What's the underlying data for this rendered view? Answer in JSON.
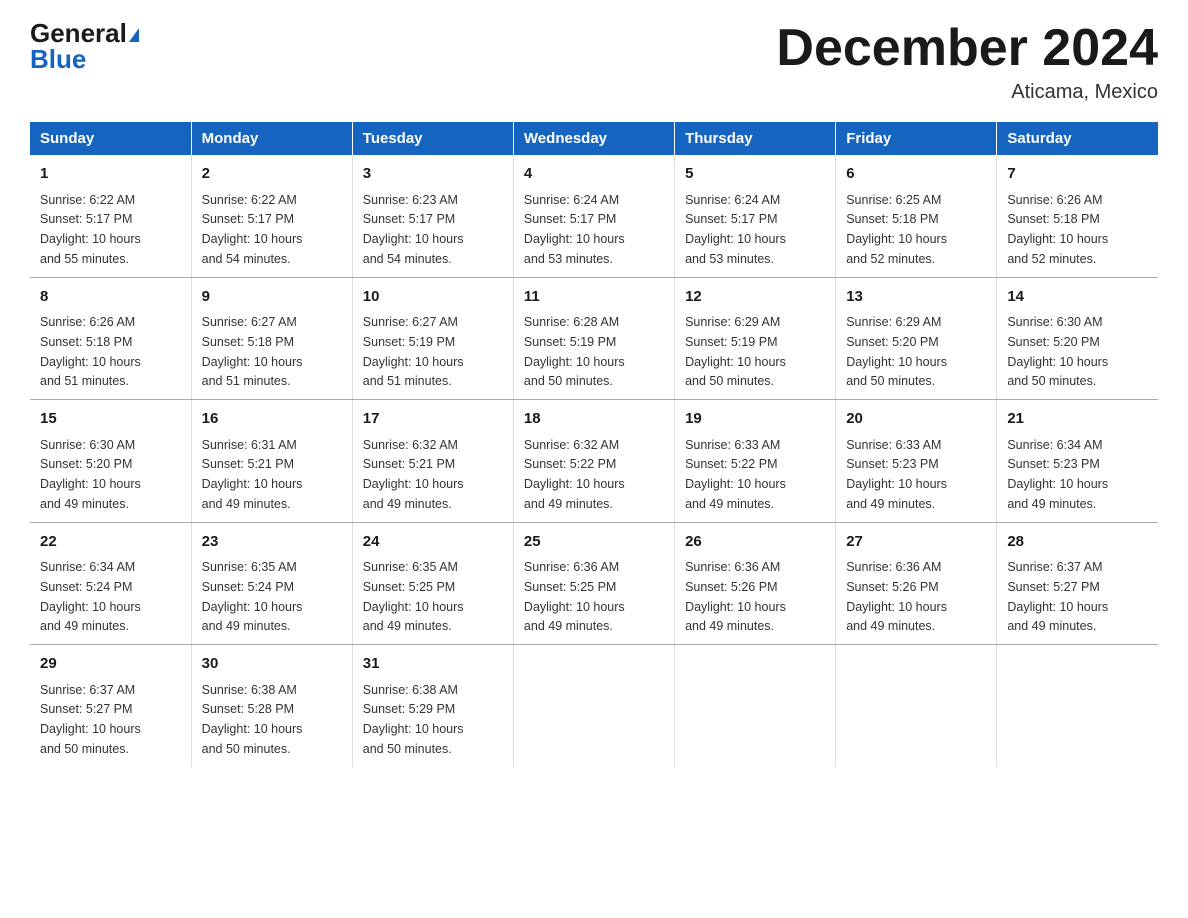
{
  "header": {
    "logo_general": "General",
    "logo_blue": "Blue",
    "month_title": "December 2024",
    "location": "Aticama, Mexico"
  },
  "days_of_week": [
    "Sunday",
    "Monday",
    "Tuesday",
    "Wednesday",
    "Thursday",
    "Friday",
    "Saturday"
  ],
  "weeks": [
    [
      {
        "day": "1",
        "sunrise": "6:22 AM",
        "sunset": "5:17 PM",
        "daylight": "10 hours and 55 minutes."
      },
      {
        "day": "2",
        "sunrise": "6:22 AM",
        "sunset": "5:17 PM",
        "daylight": "10 hours and 54 minutes."
      },
      {
        "day": "3",
        "sunrise": "6:23 AM",
        "sunset": "5:17 PM",
        "daylight": "10 hours and 54 minutes."
      },
      {
        "day": "4",
        "sunrise": "6:24 AM",
        "sunset": "5:17 PM",
        "daylight": "10 hours and 53 minutes."
      },
      {
        "day": "5",
        "sunrise": "6:24 AM",
        "sunset": "5:17 PM",
        "daylight": "10 hours and 53 minutes."
      },
      {
        "day": "6",
        "sunrise": "6:25 AM",
        "sunset": "5:18 PM",
        "daylight": "10 hours and 52 minutes."
      },
      {
        "day": "7",
        "sunrise": "6:26 AM",
        "sunset": "5:18 PM",
        "daylight": "10 hours and 52 minutes."
      }
    ],
    [
      {
        "day": "8",
        "sunrise": "6:26 AM",
        "sunset": "5:18 PM",
        "daylight": "10 hours and 51 minutes."
      },
      {
        "day": "9",
        "sunrise": "6:27 AM",
        "sunset": "5:18 PM",
        "daylight": "10 hours and 51 minutes."
      },
      {
        "day": "10",
        "sunrise": "6:27 AM",
        "sunset": "5:19 PM",
        "daylight": "10 hours and 51 minutes."
      },
      {
        "day": "11",
        "sunrise": "6:28 AM",
        "sunset": "5:19 PM",
        "daylight": "10 hours and 50 minutes."
      },
      {
        "day": "12",
        "sunrise": "6:29 AM",
        "sunset": "5:19 PM",
        "daylight": "10 hours and 50 minutes."
      },
      {
        "day": "13",
        "sunrise": "6:29 AM",
        "sunset": "5:20 PM",
        "daylight": "10 hours and 50 minutes."
      },
      {
        "day": "14",
        "sunrise": "6:30 AM",
        "sunset": "5:20 PM",
        "daylight": "10 hours and 50 minutes."
      }
    ],
    [
      {
        "day": "15",
        "sunrise": "6:30 AM",
        "sunset": "5:20 PM",
        "daylight": "10 hours and 49 minutes."
      },
      {
        "day": "16",
        "sunrise": "6:31 AM",
        "sunset": "5:21 PM",
        "daylight": "10 hours and 49 minutes."
      },
      {
        "day": "17",
        "sunrise": "6:32 AM",
        "sunset": "5:21 PM",
        "daylight": "10 hours and 49 minutes."
      },
      {
        "day": "18",
        "sunrise": "6:32 AM",
        "sunset": "5:22 PM",
        "daylight": "10 hours and 49 minutes."
      },
      {
        "day": "19",
        "sunrise": "6:33 AM",
        "sunset": "5:22 PM",
        "daylight": "10 hours and 49 minutes."
      },
      {
        "day": "20",
        "sunrise": "6:33 AM",
        "sunset": "5:23 PM",
        "daylight": "10 hours and 49 minutes."
      },
      {
        "day": "21",
        "sunrise": "6:34 AM",
        "sunset": "5:23 PM",
        "daylight": "10 hours and 49 minutes."
      }
    ],
    [
      {
        "day": "22",
        "sunrise": "6:34 AM",
        "sunset": "5:24 PM",
        "daylight": "10 hours and 49 minutes."
      },
      {
        "day": "23",
        "sunrise": "6:35 AM",
        "sunset": "5:24 PM",
        "daylight": "10 hours and 49 minutes."
      },
      {
        "day": "24",
        "sunrise": "6:35 AM",
        "sunset": "5:25 PM",
        "daylight": "10 hours and 49 minutes."
      },
      {
        "day": "25",
        "sunrise": "6:36 AM",
        "sunset": "5:25 PM",
        "daylight": "10 hours and 49 minutes."
      },
      {
        "day": "26",
        "sunrise": "6:36 AM",
        "sunset": "5:26 PM",
        "daylight": "10 hours and 49 minutes."
      },
      {
        "day": "27",
        "sunrise": "6:36 AM",
        "sunset": "5:26 PM",
        "daylight": "10 hours and 49 minutes."
      },
      {
        "day": "28",
        "sunrise": "6:37 AM",
        "sunset": "5:27 PM",
        "daylight": "10 hours and 49 minutes."
      }
    ],
    [
      {
        "day": "29",
        "sunrise": "6:37 AM",
        "sunset": "5:27 PM",
        "daylight": "10 hours and 50 minutes."
      },
      {
        "day": "30",
        "sunrise": "6:38 AM",
        "sunset": "5:28 PM",
        "daylight": "10 hours and 50 minutes."
      },
      {
        "day": "31",
        "sunrise": "6:38 AM",
        "sunset": "5:29 PM",
        "daylight": "10 hours and 50 minutes."
      },
      null,
      null,
      null,
      null
    ]
  ],
  "labels": {
    "sunrise": "Sunrise:",
    "sunset": "Sunset:",
    "daylight": "Daylight:"
  }
}
